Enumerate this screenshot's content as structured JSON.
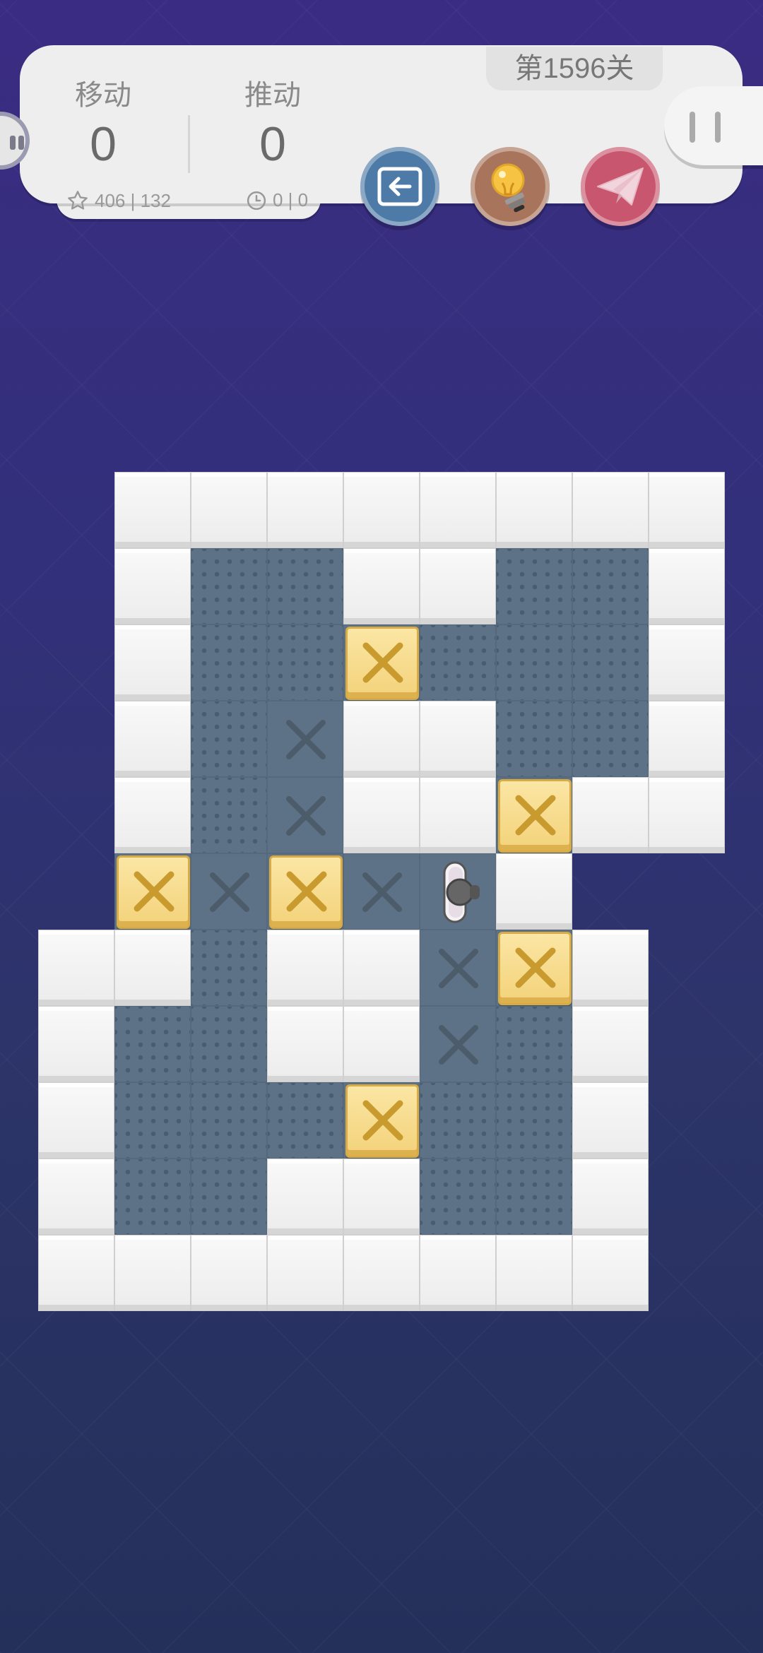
{
  "header": {
    "level_label": "第1596关",
    "moves_label": "移动",
    "moves_value": "0",
    "pushes_label": "推动",
    "pushes_value": "0",
    "stars_text": "406 | 132",
    "time_text": "0 | 0"
  },
  "buttons": {
    "undo_icon": "arrow-left-icon",
    "hint_icon": "lightbulb-icon",
    "share_icon": "paper-plane-icon",
    "pause_icon": "pause-icon"
  },
  "colors": {
    "undo": "#4d7aa6",
    "hint": "#a8755c",
    "share": "#c8566e",
    "floor": "#5d7286",
    "box": "#f3d27a"
  },
  "board": {
    "cols": 8,
    "rows": 11,
    "legend": {
      "#": "wall",
      ".": "floor",
      "x": "goal",
      "B": "box",
      "*": "box-on-goal",
      "@": "player",
      " ": "empty"
    },
    "grid": [
      " ########",
      " #..##..#",
      " #..*...#",
      " #.x##..#",
      " #.x##*##",
      " *x*x@# ",
      "##.##x*# ",
      "#..##x.# ",
      "#...*..# ",
      "#..##..# ",
      "######## "
    ]
  }
}
